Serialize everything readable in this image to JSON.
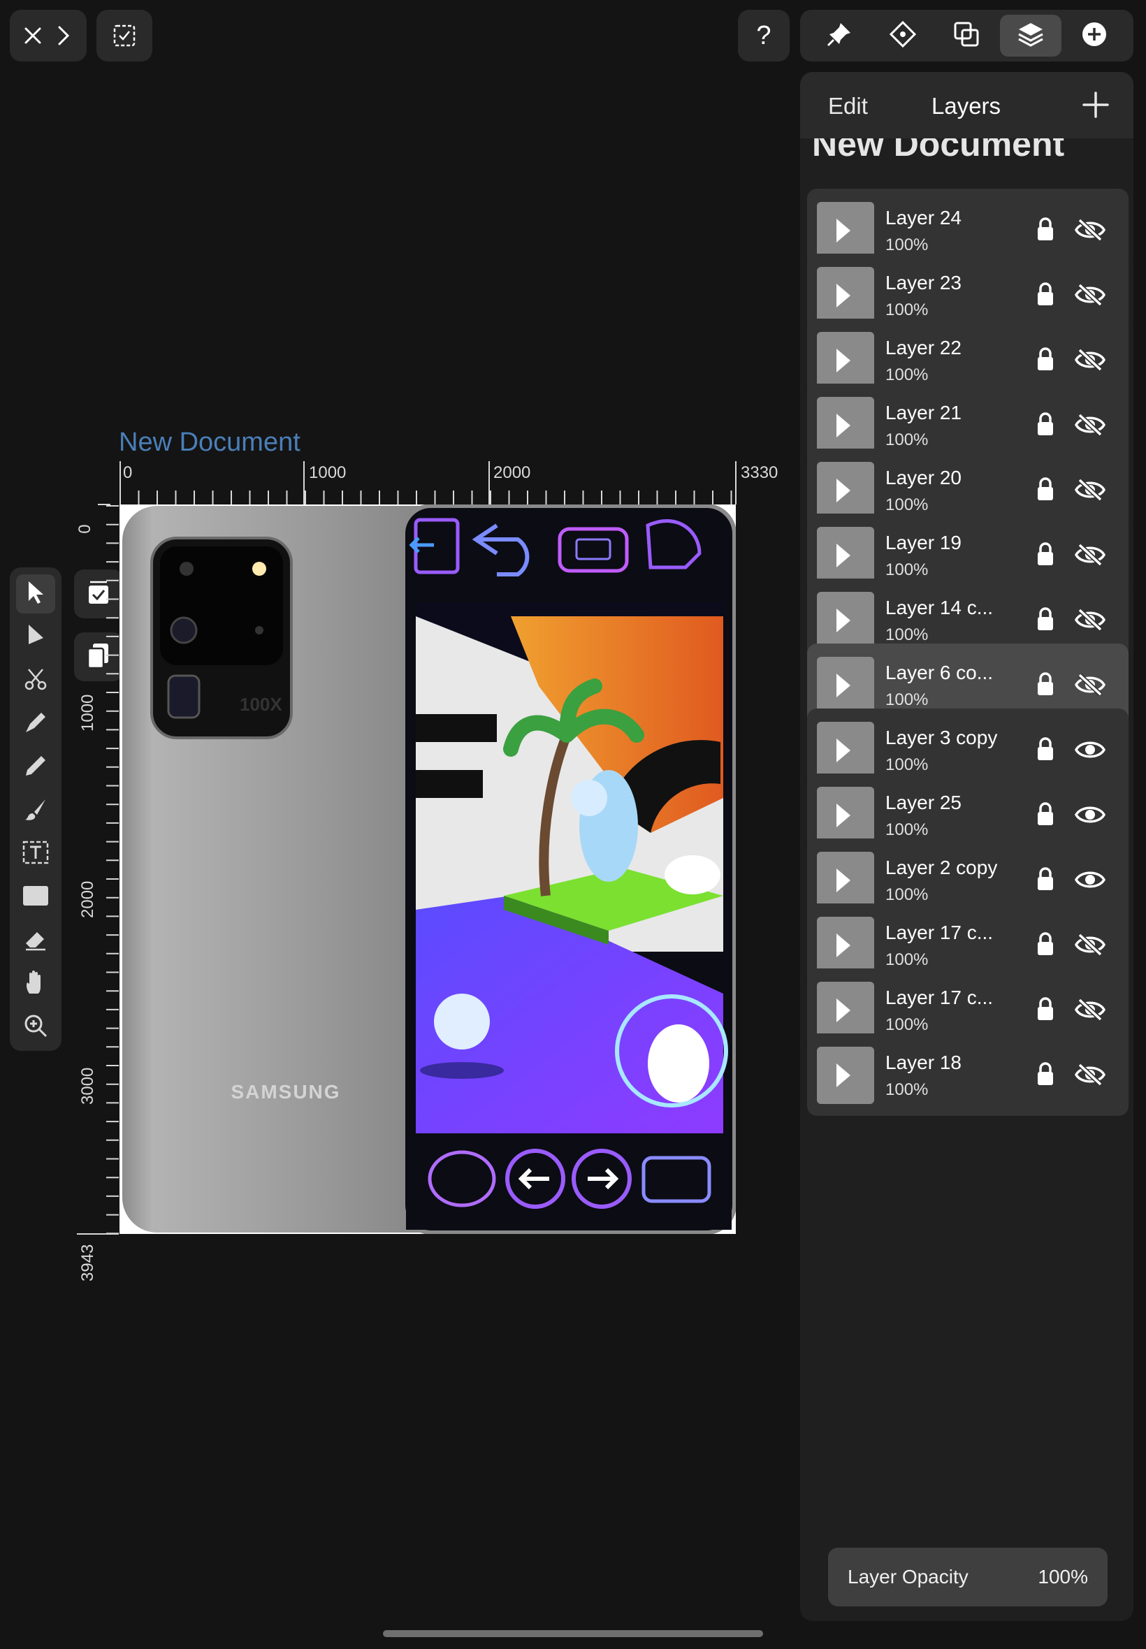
{
  "header": {
    "close_icon": "close-icon",
    "forward_icon": "chevron-right-icon",
    "select_icon": "checkbox-icon",
    "help_label": "?",
    "tools": [
      "pin-icon",
      "node-icon",
      "boolean-icon",
      "layers-icon",
      "add-circle-icon"
    ]
  },
  "panel": {
    "tab_edit": "Edit",
    "tab_layers": "Layers",
    "document_title": "New Document",
    "layers": [
      {
        "name": "Layer 24",
        "opacity": "100%",
        "visible": false,
        "selected": false
      },
      {
        "name": "Layer 23",
        "opacity": "100%",
        "visible": false,
        "selected": false
      },
      {
        "name": "Layer 22",
        "opacity": "100%",
        "visible": false,
        "selected": false
      },
      {
        "name": "Layer 21",
        "opacity": "100%",
        "visible": false,
        "selected": false
      },
      {
        "name": "Layer 20",
        "opacity": "100%",
        "visible": false,
        "selected": false
      },
      {
        "name": "Layer 19",
        "opacity": "100%",
        "visible": false,
        "selected": false
      },
      {
        "name": "Layer 14 c...",
        "opacity": "100%",
        "visible": false,
        "selected": false
      },
      {
        "name": "Layer 6 co...",
        "opacity": "100%",
        "visible": false,
        "selected": true
      },
      {
        "name": "Layer 3 copy",
        "opacity": "100%",
        "visible": true,
        "selected": false
      },
      {
        "name": "Layer 25",
        "opacity": "100%",
        "visible": true,
        "selected": false
      },
      {
        "name": "Layer 2 copy",
        "opacity": "100%",
        "visible": true,
        "selected": false
      },
      {
        "name": "Layer 17 c...",
        "opacity": "100%",
        "visible": false,
        "selected": false
      },
      {
        "name": "Layer 17 c...",
        "opacity": "100%",
        "visible": false,
        "selected": false
      },
      {
        "name": "Layer 18",
        "opacity": "100%",
        "visible": false,
        "selected": false
      }
    ],
    "opacity_label": "Layer Opacity",
    "opacity_value": "100%"
  },
  "canvas": {
    "title": "New Document",
    "ruler_h": [
      "0",
      "1000",
      "2000",
      "3330"
    ],
    "ruler_v": [
      "0",
      "1000",
      "2000",
      "3000",
      "3943"
    ],
    "phone_brand": "SAMSUNG",
    "camera_label": "100X"
  },
  "colors": {
    "accent": "#4a7fb8",
    "panel": "#1f1f1f",
    "layer_row": "#333333",
    "selected_row": "#4a4a4a"
  }
}
